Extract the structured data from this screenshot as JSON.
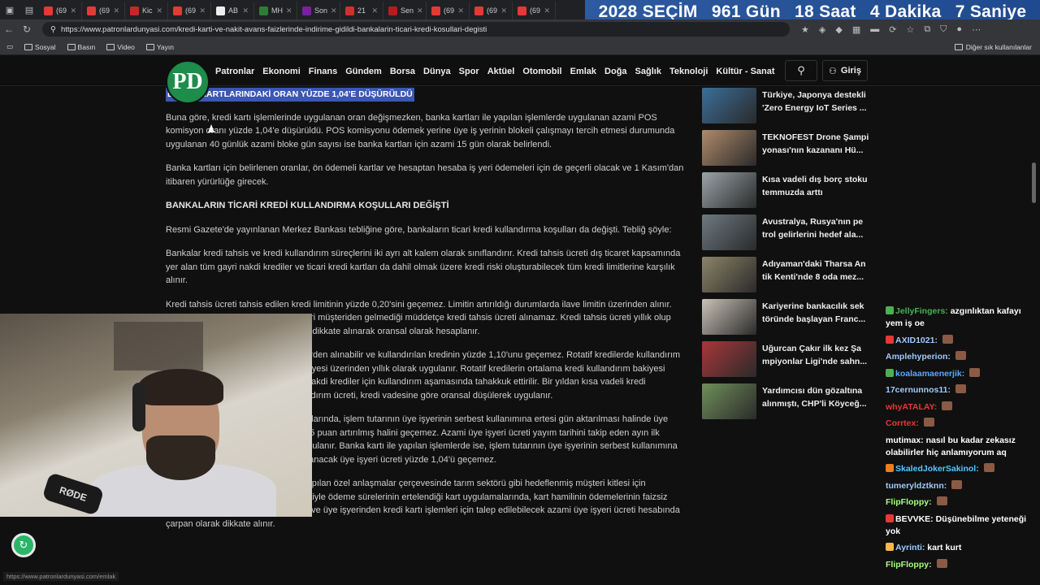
{
  "countdown": {
    "year": "2028 SEÇİM",
    "days": "961 Gün",
    "hours": "18 Saat",
    "minutes": "4 Dakika",
    "seconds": "7 Saniye"
  },
  "tabs": [
    {
      "label": "(69",
      "color": "#e53935"
    },
    {
      "label": "(69",
      "color": "#e53935"
    },
    {
      "label": "Kic",
      "color": "#c62828"
    },
    {
      "label": "(69",
      "color": "#e53935"
    },
    {
      "label": "AB",
      "color": "#eeeeee"
    },
    {
      "label": "MH",
      "color": "#2e7d32"
    },
    {
      "label": "Son",
      "color": "#7b1fa2"
    },
    {
      "label": "21",
      "color": "#d32f2f"
    },
    {
      "label": "Sen",
      "color": "#b71c1c"
    },
    {
      "label": "(69",
      "color": "#e53935"
    },
    {
      "label": "(69",
      "color": "#e53935"
    },
    {
      "label": "(69",
      "color": "#e53935"
    }
  ],
  "address": {
    "url": "https://www.patronlardunyasi.com/kredi-karti-ve-nakit-avans-faizlerinde-indirime-gidildi-bankalarin-ticari-kredi-kosullari-degisti"
  },
  "bookmarks": {
    "items": [
      "Sosyal",
      "Basın",
      "Video",
      "Yayın"
    ],
    "other": "Diğer sık kullanılanlar"
  },
  "site": {
    "logo_text": "PD",
    "nav": [
      "Patronlar",
      "Ekonomi",
      "Finans",
      "Gündem",
      "Borsa",
      "Dünya",
      "Spor",
      "Aktüel",
      "Otomobil",
      "Emlak",
      "Doğa",
      "Sağlık",
      "Teknoloji",
      "Kültür - Sanat"
    ],
    "login": "Giriş"
  },
  "article": {
    "highlight": "BANKA KARTLARINDAKİ ORAN YÜZDE 1,04'E DÜŞÜRÜLDÜ",
    "p1": "Buna göre, kredi kartı işlemlerinde uygulanan oran değişmezken, banka kartları ile yapılan işlemlerde uygulanan azami POS komisyon oranı yüzde 1,04'e düşürüldü. POS komisyonu ödemek yerine üye iş yerinin blokeli çalışmayı tercih etmesi durumunda uygulanan 40 günlük azami bloke gün sayısı ise banka kartları için azami 15 gün olarak belirlendi.",
    "p2": "Banka kartları için belirlenen oranlar, ön ödemeli kartlar ve hesaptan hesaba iş yeri ödemeleri için de geçerli olacak ve 1 Kasım'dan itibaren yürürlüğe girecek.",
    "h2": "BANKALARIN TİCARİ KREDİ KULLANDIRMA KOŞULLARI DEĞİŞTİ",
    "p3": "Resmi Gazete'de yayınlanan Merkez Bankası tebliğine göre, bankaların ticari kredi kullandırma koşulları da değişti. Tebliğ şöyle:",
    "p4": "Bankalar kredi tahsis ve kredi kullandırım süreçlerini iki ayrı alt kalem olarak sınıflandırır. Kredi tahsis ücreti dış ticaret kapsamında yer alan tüm gayri nakdi krediler ve ticari kredi kartları da dahil olmak üzere kredi riski oluşturabilecek tüm kredi limitlerine karşılık alınır.",
    "p5": "Kredi tahsis ücreti tahsis edilen kredi limitinin yüzde 0,20'sini geçemez. Limitin artırıldığı durumlarda ilave limitin üzerinden alınır. Limit tahsis veya yenileme talebi ticari müşteriden gelmediği müddetçe kredi tahsis ücreti alınamaz. Kredi tahsis ücreti yıllık olup tahsis edilen limit süresinin ay sayısı dikkate alınarak oransal olarak hesaplanır.",
    "p6": "Kredi kullandırım ücreti nakdi kredilerden alınabilir ve kullandırılan kredinin yüzde 1,10'unu geçemez. Rotatif kredilerde kullandırım ücreti ortalama kredi kullandırım bakiyesi üzerinden yıllık olarak uygulanır. Rotatif kredilerin ortalama kredi kullandırım bakiyesi üzerinden dönem sonlarında, diğer nakdi krediler için kullandırım aşamasında tahakkuk ettirilir. Bir yıldan kısa vadeli kredi kullandırımlarında azami kredi kullandırım ücreti, kredi vadesine göre oransal düşülerek uygulanır.",
    "p7": "Bankaların üye iş yeri ve hizmet alımlarında, işlem tutarının üye işyerinin serbest kullanımına ertesi gün aktarılması halinde üye işyeri ücreti aylık referans oranın 0,45 puan artırılmış halini geçemez. Azami üye işyeri ücreti yayım tarihini takip eden ayın ilk gününden itibaren güncellenerek uygulanır. Banka kartı ile yapılan işlemlerde ise, işlem tutarının üye işyerinin serbest kullanımına ertesi gün aktarılması halinde, uygulanacak üye işyeri ücreti yüzde 1,04'ü geçemez.",
    "p8": "Bankalar ile üye işyerleri arasında yapılan özel anlaşmalar çerçevesinde tarım sektörü gibi hedeflenmiş müşteri kitlesi için tasarlanmış kartlar kabul etmek suretiyle ödeme sürelerinin ertelendiği kart uygulamalarında, kart hamilinin ödemelerinin faizsiz ötelendiği süreler ay olarak belirlenir ve üye işyerinden kredi kartı işlemleri için talep edilebilecek azami üye işyeri ücreti hesabında çarpan olarak dikkate alınır."
  },
  "sidebar": [
    {
      "title": "Türkiye, Japonya destekli 'Zero Energy IoT Series ...",
      "thumb": "#3a6f9a"
    },
    {
      "title": "TEKNOFEST Drone Şampi yonası'nın kazananı Hü...",
      "thumb": "#b08a6a"
    },
    {
      "title": "Kısa vadeli dış borç stoku temmuzda arttı",
      "thumb": "#9aa4a8"
    },
    {
      "title": "Avustralya, Rusya'nın pe trol gelirlerini hedef ala...",
      "thumb": "#6d7a82"
    },
    {
      "title": "Adıyaman'daki Tharsa An tik Kenti'nde 8 oda mez...",
      "thumb": "#8c8468"
    },
    {
      "title": "Kariyerine bankacılık sek töründe başlayan Franc...",
      "thumb": "#c9c2b6"
    },
    {
      "title": "Uğurcan Çakır ilk kez Şa mpiyonlar Ligi'nde sahn...",
      "thumb": "#a8373a"
    },
    {
      "title": "Yardımcısı dün gözaltına alınmıştı, CHP'li Köyceğ...",
      "thumb": "#6f8f5a"
    }
  ],
  "webcam": {
    "mic_label": "RØDE"
  },
  "chat": [
    {
      "user": "JellyFingers:",
      "msg": "azgınlıktan kafayı yem iş oe",
      "color": "#4caf50",
      "badge": "#4caf50"
    },
    {
      "user": "AXID1021:",
      "msg": "",
      "color": "#9ecbff",
      "badge": "#e53935"
    },
    {
      "user": "Amplehyperion:",
      "msg": "",
      "color": "#9ecbff",
      "badge": ""
    },
    {
      "user": "koalaamaenerjik:",
      "msg": "",
      "color": "#57a8ff",
      "badge": "#4caf50"
    },
    {
      "user": "17cernunnos11:",
      "msg": "",
      "color": "#9ecbff",
      "badge": ""
    },
    {
      "user": "whyATALAY:",
      "msg": "",
      "color": "#e53935",
      "badge": ""
    },
    {
      "user": "Corrtex:",
      "msg": "",
      "color": "#e53935",
      "badge": ""
    },
    {
      "user": "mutimax:",
      "msg": "nasıl bu kadar zekasız olabilirler hiç anlamıyorum aq",
      "color": "#ffffff",
      "badge": ""
    },
    {
      "user": "SkaledJokerSakinol:",
      "msg": "",
      "color": "#57c7ff",
      "badge": "#e67e22"
    },
    {
      "user": "tumeryldztknn:",
      "msg": "",
      "color": "#9ecbff",
      "badge": ""
    },
    {
      "user": "FlipFloppy:",
      "msg": "",
      "color": "#a5ff7a",
      "badge": ""
    },
    {
      "user": "BEVVKE:",
      "msg": "Düşünebilme yeteneği yok",
      "color": "#ffffff",
      "badge": "#e53935"
    },
    {
      "user": "Ayrinti:",
      "msg": "kart kurt",
      "color": "#9ecbff",
      "badge": "#ffb74d"
    },
    {
      "user": "FlipFloppy:",
      "msg": "",
      "color": "#a5ff7a",
      "badge": ""
    }
  ],
  "statusbar": {
    "text": "https://www.patronlardunyasi.com/emlak"
  }
}
